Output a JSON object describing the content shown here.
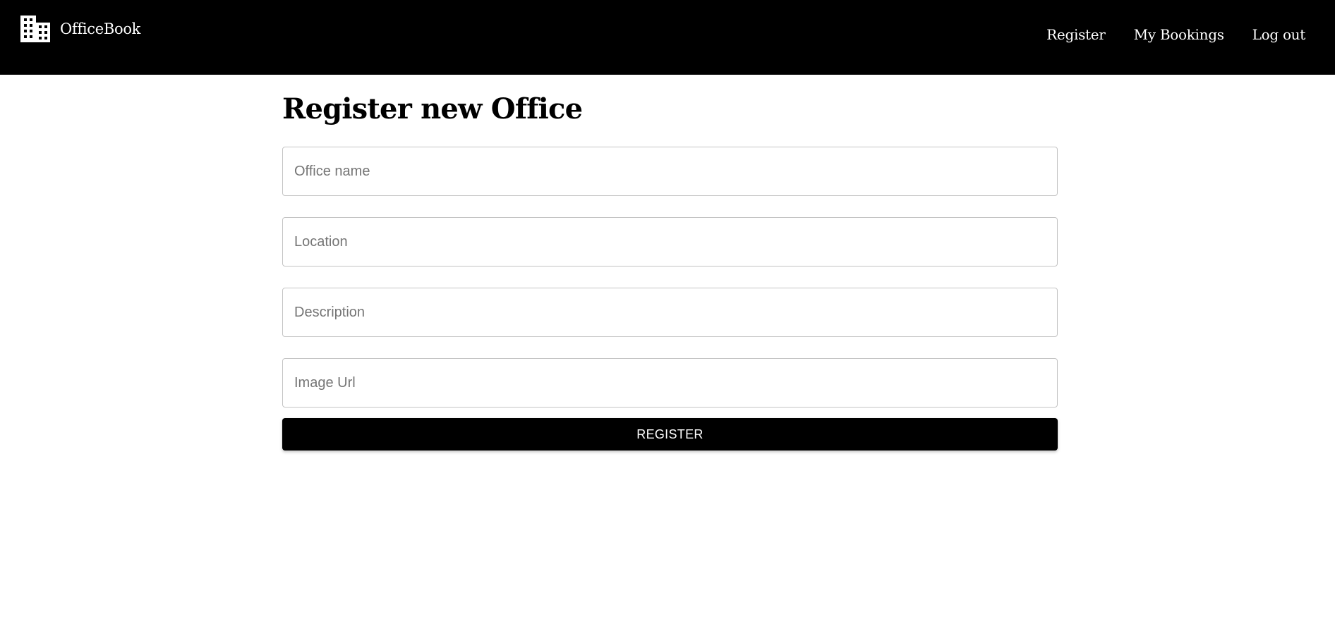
{
  "app": {
    "brand_name": "OfficeBook",
    "brand_icon": "office-building-icon"
  },
  "nav": {
    "items": [
      {
        "label": "Register"
      },
      {
        "label": "My Bookings"
      },
      {
        "label": "Log out"
      }
    ]
  },
  "page": {
    "title": "Register new Office"
  },
  "form": {
    "office_name": {
      "placeholder": "Office name",
      "value": ""
    },
    "location": {
      "placeholder": "Location",
      "value": ""
    },
    "description": {
      "placeholder": "Description",
      "value": ""
    },
    "image_url": {
      "placeholder": "Image Url",
      "value": ""
    },
    "submit_label": "REGISTER"
  },
  "colors": {
    "header_background": "#000000",
    "header_text": "#ffffff",
    "button_background": "#000000",
    "button_text": "#ffffff",
    "field_border": "#c4c4c4",
    "placeholder_text": "#757575"
  }
}
